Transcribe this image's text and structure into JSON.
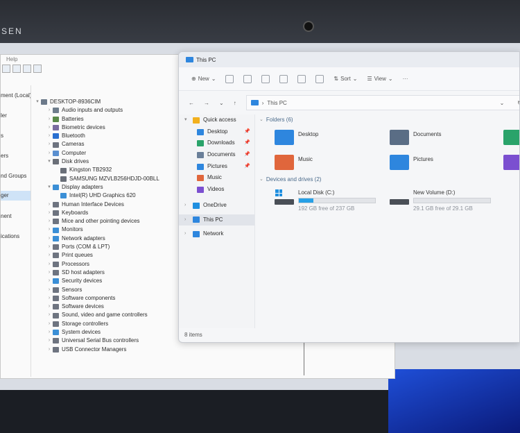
{
  "bezel": {
    "brand": "SEN"
  },
  "device_manager": {
    "menu": "Help",
    "left_labels": [
      "ment (Local)",
      "ler",
      "s",
      "ers",
      "nd Groups",
      "ger",
      "nent",
      "ications"
    ],
    "tree": [
      {
        "level": 0,
        "arrow": "▾",
        "label": "DESKTOP-8936CIM",
        "color": "#6c7a8a"
      },
      {
        "level": 1,
        "arrow": "›",
        "label": "Audio inputs and outputs",
        "color": "#6e7d8c"
      },
      {
        "level": 1,
        "arrow": "›",
        "label": "Batteries",
        "color": "#5a8a4a"
      },
      {
        "level": 1,
        "arrow": "›",
        "label": "Biometric devices",
        "color": "#7a6ca0"
      },
      {
        "level": 1,
        "arrow": "›",
        "label": "Bluetooth",
        "color": "#2a6fd0"
      },
      {
        "level": 1,
        "arrow": "›",
        "label": "Cameras",
        "color": "#6e7480"
      },
      {
        "level": 1,
        "arrow": "›",
        "label": "Computer",
        "color": "#5a8fd0"
      },
      {
        "level": 1,
        "arrow": "▾",
        "label": "Disk drives",
        "color": "#6a6f78"
      },
      {
        "level": 2,
        "arrow": "",
        "label": "Kingston TB2932",
        "color": "#6a6f78"
      },
      {
        "level": 2,
        "arrow": "",
        "label": "SAMSUNG MZVLB256HDJD-00BLL",
        "color": "#6a6f78"
      },
      {
        "level": 1,
        "arrow": "▾",
        "label": "Display adapters",
        "color": "#3b8fd6"
      },
      {
        "level": 2,
        "arrow": "",
        "label": "Intel(R) UHD Graphics 620",
        "color": "#3b8fd6"
      },
      {
        "level": 1,
        "arrow": "›",
        "label": "Human Interface Devices",
        "color": "#6e7480"
      },
      {
        "level": 1,
        "arrow": "›",
        "label": "Keyboards",
        "color": "#6e7480"
      },
      {
        "level": 1,
        "arrow": "›",
        "label": "Mice and other pointing devices",
        "color": "#6e7480"
      },
      {
        "level": 1,
        "arrow": "›",
        "label": "Monitors",
        "color": "#3b8fd6"
      },
      {
        "level": 1,
        "arrow": "›",
        "label": "Network adapters",
        "color": "#3b8fd6"
      },
      {
        "level": 1,
        "arrow": "›",
        "label": "Ports (COM & LPT)",
        "color": "#6e7480"
      },
      {
        "level": 1,
        "arrow": "›",
        "label": "Print queues",
        "color": "#6e7480"
      },
      {
        "level": 1,
        "arrow": "›",
        "label": "Processors",
        "color": "#6e7480"
      },
      {
        "level": 1,
        "arrow": "›",
        "label": "SD host adapters",
        "color": "#6e7480"
      },
      {
        "level": 1,
        "arrow": "›",
        "label": "Security devices",
        "color": "#3b8fd6"
      },
      {
        "level": 1,
        "arrow": "›",
        "label": "Sensors",
        "color": "#6e7480"
      },
      {
        "level": 1,
        "arrow": "›",
        "label": "Software components",
        "color": "#6e7480"
      },
      {
        "level": 1,
        "arrow": "›",
        "label": "Software devices",
        "color": "#6e7480"
      },
      {
        "level": 1,
        "arrow": "›",
        "label": "Sound, video and game controllers",
        "color": "#6e7480"
      },
      {
        "level": 1,
        "arrow": "›",
        "label": "Storage controllers",
        "color": "#6e7480"
      },
      {
        "level": 1,
        "arrow": "›",
        "label": "System devices",
        "color": "#3b8fd6"
      },
      {
        "level": 1,
        "arrow": "›",
        "label": "Universal Serial Bus controllers",
        "color": "#6e7480"
      },
      {
        "level": 1,
        "arrow": "›",
        "label": "USB Connector Managers",
        "color": "#6e7480"
      }
    ]
  },
  "explorer": {
    "title": "This PC",
    "commands": {
      "new": "New",
      "sort": "Sort",
      "view": "View",
      "more": "···"
    },
    "address": "This PC",
    "nav": [
      {
        "label": "Quick access",
        "arrow": "▾",
        "icon": "star-icon",
        "color": "#f2b01e",
        "pinned": false,
        "indent": 0
      },
      {
        "label": "Desktop",
        "arrow": "",
        "icon": "desktop-icon",
        "color": "#2e86de",
        "pinned": true,
        "indent": 1
      },
      {
        "label": "Downloads",
        "arrow": "",
        "icon": "download-icon",
        "color": "#2aa36a",
        "pinned": true,
        "indent": 1
      },
      {
        "label": "Documents",
        "arrow": "",
        "icon": "documents-icon",
        "color": "#6a7f99",
        "pinned": true,
        "indent": 1
      },
      {
        "label": "Pictures",
        "arrow": "",
        "icon": "pictures-icon",
        "color": "#2e86de",
        "pinned": true,
        "indent": 1
      },
      {
        "label": "Music",
        "arrow": "",
        "icon": "music-icon",
        "color": "#e0663c",
        "pinned": false,
        "indent": 1
      },
      {
        "label": "Videos",
        "arrow": "",
        "icon": "videos-icon",
        "color": "#7b4fd0",
        "pinned": false,
        "indent": 1
      },
      {
        "label": "OneDrive",
        "arrow": "›",
        "icon": "cloud-icon",
        "color": "#1f8fe0",
        "pinned": false,
        "indent": 0
      },
      {
        "label": "This PC",
        "arrow": "›",
        "icon": "computer-icon",
        "color": "#2e86de",
        "pinned": false,
        "indent": 0,
        "selected": true
      },
      {
        "label": "Network",
        "arrow": "›",
        "icon": "network-icon",
        "color": "#2e86de",
        "pinned": false,
        "indent": 0
      }
    ],
    "folders_header": "Folders (6)",
    "folders": [
      {
        "label": "Desktop",
        "color": "#2e86de"
      },
      {
        "label": "Documents",
        "color": "#5a6d85"
      },
      {
        "label": "",
        "color": "#2aa36a"
      },
      {
        "label": "Music",
        "color": "#e0663c"
      },
      {
        "label": "Pictures",
        "color": "#2e86de"
      },
      {
        "label": "",
        "color": "#7b4fd0"
      }
    ],
    "drives_header": "Devices and drives (2)",
    "drives": [
      {
        "name": "Local Disk (C:)",
        "free": "192 GB free of 237 GB",
        "used_fraction": 0.19
      },
      {
        "name": "New Volume (D:)",
        "free": "29.1 GB free of 29.1 GB",
        "used_fraction": 0.0
      }
    ],
    "status": "8 items"
  }
}
